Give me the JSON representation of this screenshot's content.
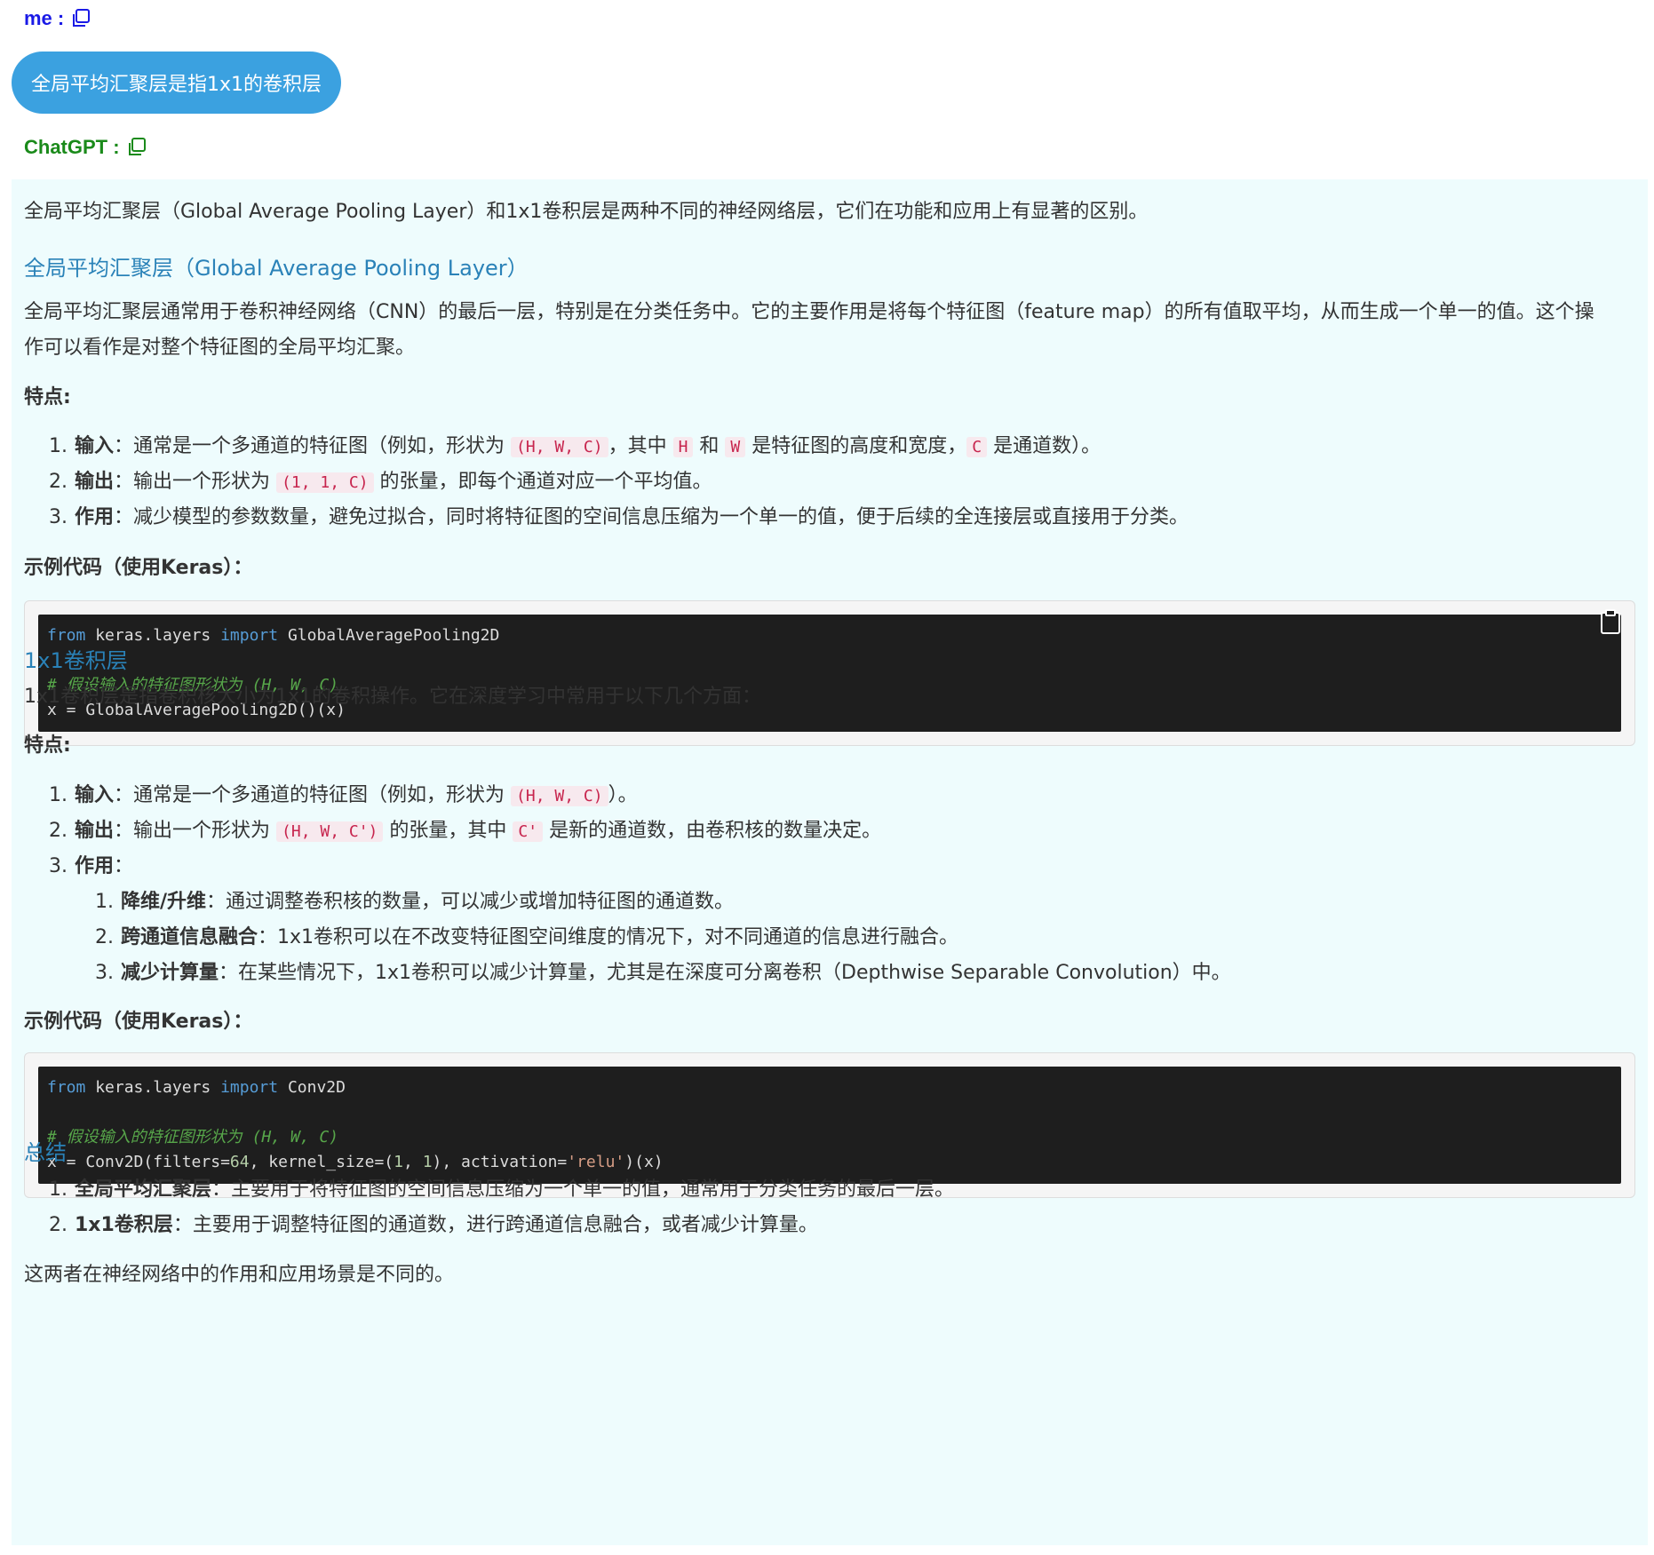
{
  "me": {
    "label": "me :"
  },
  "user_message": "全局平均汇聚层是指1x1的卷积层",
  "gpt": {
    "label": "ChatGPT :"
  },
  "answer": {
    "intro": "全局平均汇聚层（Global Average Pooling Layer）和1x1卷积层是两种不同的神经网络层，它们在功能和应用上有显著的区别。",
    "gap": {
      "heading": "全局平均汇聚层（Global Average Pooling Layer）",
      "desc_line1": "全局平均汇聚层通常用于卷积神经网络（CNN）的最后一层，特别是在分类任务中。它的主要作用是将每个特征图（feature map）的所有值取平均，从而生成一个单一的值。这个操",
      "desc_line2": "作可以看作是对整个特征图的全局平均汇聚。",
      "features_label": "特点:",
      "items": [
        {
          "num": "1.",
          "bold": "输入",
          "pre": "：通常是一个多通道的特征图（例如，形状为 ",
          "code1": "(H, W, C)",
          "mid1": "，其中 ",
          "code2": "H",
          "mid2": " 和 ",
          "code3": "W",
          "mid3": " 是特征图的高度和宽度，",
          "code4": "C",
          "post": " 是通道数）。"
        },
        {
          "num": "2.",
          "bold": "输出",
          "pre": "：输出一个形状为 ",
          "code1": "(1, 1, C)",
          "post": " 的张量，即每个通道对应一个平均值。"
        },
        {
          "num": "3.",
          "bold": "作用",
          "pre": "：减少模型的参数数量，避免过拟合，同时将特征图的空间信息压缩为一个单一的值，便于后续的全连接层或直接用于分类。"
        }
      ],
      "example_label": "示例代码（使用Keras）：",
      "code": {
        "l1_kw1": "from",
        "l1_a": " keras.layers ",
        "l1_kw2": "import",
        "l1_b": " GlobalAveragePooling2D",
        "l2_comment": "# 假设输入的特征图形状为 (H, W, C)",
        "l3": "x = GlobalAveragePooling2D()(x)"
      }
    },
    "conv": {
      "heading": "1x1卷积层",
      "desc": "1x1卷积层是指卷积核大小为1x1的卷积操作。它在深度学习中常用于以下几个方面：",
      "features_label": "特点:",
      "items": [
        {
          "num": "1.",
          "bold": "输入",
          "pre": "：通常是一个多通道的特征图（例如，形状为 ",
          "code1": "(H, W, C)",
          "post": "）。"
        },
        {
          "num": "2.",
          "bold": "输出",
          "pre": "：输出一个形状为 ",
          "code1": "(H, W, C')",
          "mid1": " 的张量，其中 ",
          "code2": "C'",
          "post": " 是新的通道数，由卷积核的数量决定。"
        },
        {
          "num": "3.",
          "bold": "作用",
          "pre": "："
        }
      ],
      "subitems": [
        {
          "num": "1.",
          "bold": "降维/升维",
          "text": "：通过调整卷积核的数量，可以减少或增加特征图的通道数。"
        },
        {
          "num": "2.",
          "bold": "跨通道信息融合",
          "text": "：1x1卷积可以在不改变特征图空间维度的情况下，对不同通道的信息进行融合。"
        },
        {
          "num": "3.",
          "bold": "减少计算量",
          "text": "：在某些情况下，1x1卷积可以减少计算量，尤其是在深度可分离卷积（Depthwise Separable Convolution）中。"
        }
      ],
      "example_label": "示例代码（使用Keras）：",
      "code": {
        "l1_kw1": "from",
        "l1_a": " keras.layers ",
        "l1_kw2": "import",
        "l1_b": " Conv2D",
        "l2_comment": "# 假设输入的特征图形状为 (H, W, C)",
        "l3_a": "x = Conv2D(filters=",
        "l3_n1": "64",
        "l3_b": ", kernel_size=(",
        "l3_n2": "1",
        "l3_c": ", ",
        "l3_n3": "1",
        "l3_d": "), activation=",
        "l3_s": "'relu'",
        "l3_e": ")(x)"
      }
    },
    "summary": {
      "heading": "总结",
      "items": [
        {
          "num": "1.",
          "bold": "全局平均汇聚层",
          "text": "：主要用于将特征图的空间信息压缩为一个单一的值，通常用于分类任务的最后一层。"
        },
        {
          "num": "2.",
          "bold": "1x1卷积层",
          "text": "：主要用于调整特征图的通道数，进行跨通道信息融合，或者减少计算量。"
        }
      ],
      "closing": "这两者在神经网络中的作用和应用场景是不同的。"
    }
  }
}
